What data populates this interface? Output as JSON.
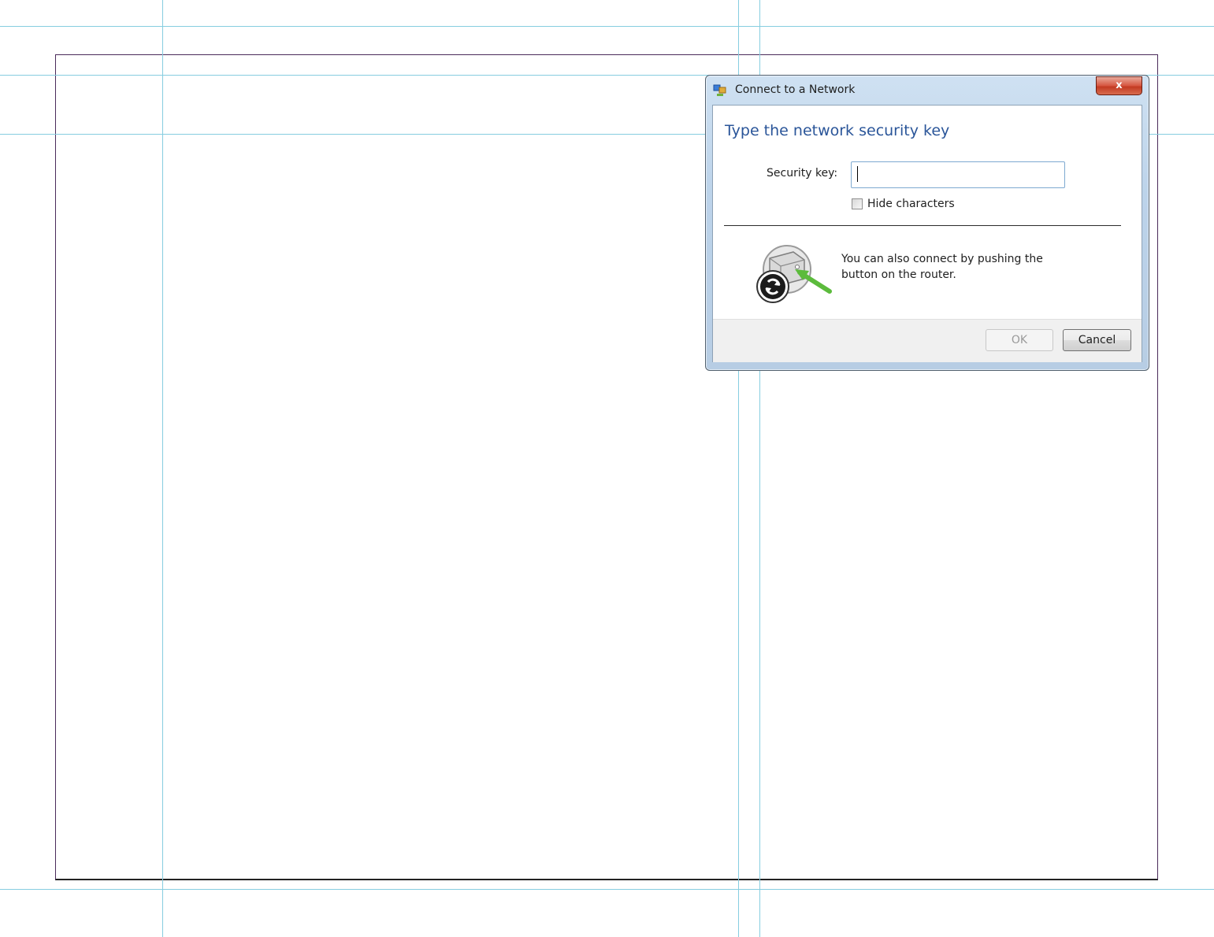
{
  "dialog": {
    "title": "Connect to a Network",
    "close_label": "x",
    "instruction": "Type the network security key",
    "security_key_label": "Security key:",
    "security_key_value": "",
    "hide_characters_label": "Hide characters",
    "hide_characters_checked": false,
    "wps_text": "You can also connect by pushing the button on the router.",
    "ok_label": "OK",
    "ok_enabled": false,
    "cancel_label": "Cancel"
  },
  "colors": {
    "instruction": "#2a5599",
    "guides": "#86cde0",
    "close_button": "#c23a22",
    "wps_arrow": "#5cbb3c"
  },
  "icons": {
    "app": "network-connect-icon",
    "close": "close-icon",
    "wps": "router-wps-button-icon"
  }
}
